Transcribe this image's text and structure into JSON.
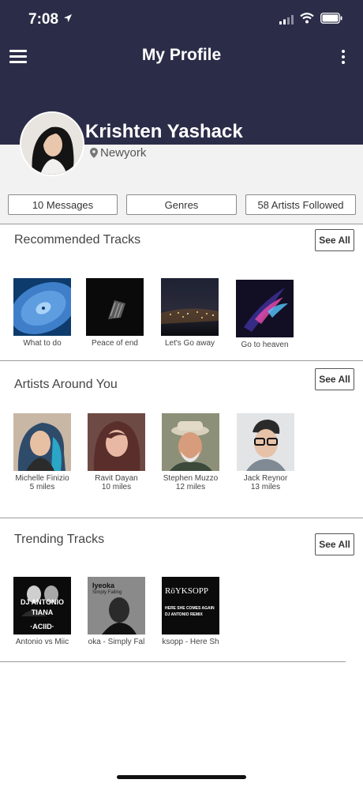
{
  "status": {
    "time": "7:08"
  },
  "header": {
    "title": "My Profile"
  },
  "profile": {
    "name": "Krishten Yashack",
    "location": "Newyork"
  },
  "stats": {
    "messages": "10 Messages",
    "genres": "Genres",
    "artists": "58 Artists Followed"
  },
  "sections": {
    "recommended": {
      "title": "Recommended Tracks",
      "see_all": "See All",
      "items": [
        {
          "label": "What to do"
        },
        {
          "label": "Peace of end"
        },
        {
          "label": "Let's Go away"
        },
        {
          "label": "Go to heaven"
        }
      ]
    },
    "artists": {
      "title": "Artists Around You",
      "see_all": "See All",
      "items": [
        {
          "name": "Michelle Finizio",
          "distance": "5 miles"
        },
        {
          "name": "Ravit Dayan",
          "distance": "10 miles"
        },
        {
          "name": "Stephen Muzzo",
          "distance": "12 miles"
        },
        {
          "name": "Jack Reynor",
          "distance": "13 miles"
        }
      ]
    },
    "trending": {
      "title": "Trending Tracks",
      "see_all": "See All",
      "items": [
        {
          "label": "Antonio vs Miic",
          "art_text": "DJ ANTONIO",
          "art_sub": "TIANA",
          "art_foot": "·ACIID·"
        },
        {
          "label": "oka - Simply Fal",
          "art_text": "Iyeoka",
          "art_sub": "Simply Falling"
        },
        {
          "label": "ksopp - Here Sh",
          "art_text": "RöYKSOPP",
          "art_sub": "HERE SHE COMES AGAIN",
          "art_foot": "DJ ANTONIO REMIX"
        }
      ]
    }
  }
}
